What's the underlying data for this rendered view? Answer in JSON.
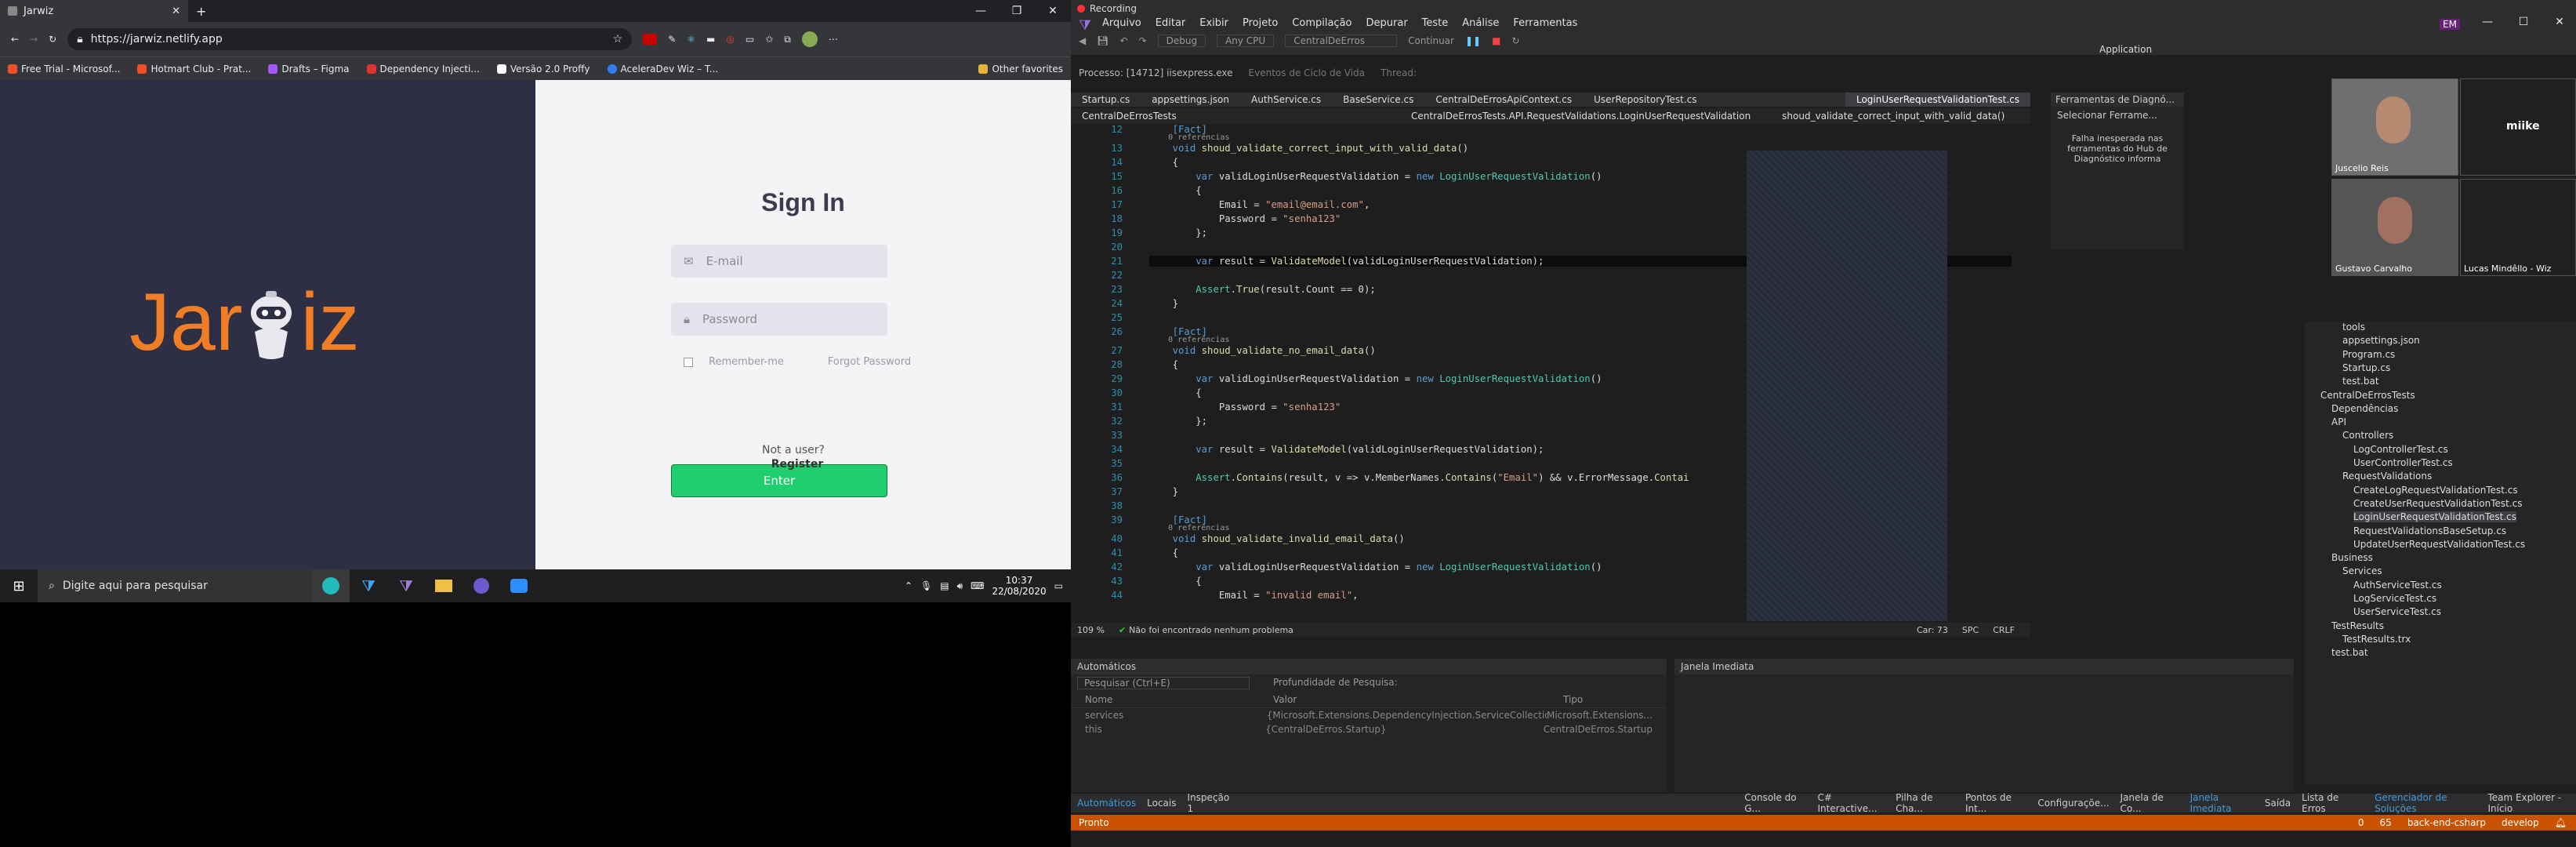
{
  "browser": {
    "tab_title": "Jarwiz",
    "url": "https://jarwiz.netlify.app",
    "bookmarks": [
      "Free Trial - Microsof...",
      "Hotmart Club - Prat...",
      "Drafts – Figma",
      "Dependency Injecti...",
      "Versão 2.0 Proffy",
      "AceleraDev Wiz – T..."
    ],
    "other_favorites": "Other favorites"
  },
  "app": {
    "logo_left": "Jar",
    "logo_right": "iz",
    "signin_title": "Sign In",
    "email_placeholder": "E-mail",
    "password_placeholder": "Password",
    "remember": "Remember-me",
    "forgot": "Forgot Password",
    "enter": "Enter",
    "not_user": "Not a user?",
    "register": "Register"
  },
  "taskbar": {
    "search": "Digite aqui para pesquisar",
    "time": "10:37",
    "date": "22/08/2020"
  },
  "vs": {
    "recording": "Recording",
    "menu": [
      "Arquivo",
      "Editar",
      "Exibir",
      "Projeto",
      "Compilação",
      "Depurar",
      "Teste",
      "Análise",
      "Ferramentas"
    ],
    "user_badge": "EM",
    "process": "Processo:  [14712] iisexpress.exe",
    "events": "Eventos de Ciclo de Vida",
    "thread": "Thread:",
    "debug": "Debug",
    "cpu": "Any CPU",
    "proj": "CentralDeErros",
    "cont": "Continuar",
    "doc_tabs": [
      "Startup.cs",
      "appsettings.json",
      "AuthService.cs",
      "BaseService.cs",
      "CentralDeErrosApiContext.cs",
      "UserRepositoryTest.cs",
      "LoginUserRequestValidationTest.cs"
    ],
    "nav_project": "CentralDeErrosTests",
    "nav_class": "CentralDeErrosTests.API.RequestValidations.LoginUserRequestValidation",
    "nav_method": "shoud_validate_correct_input_with_valid_data()",
    "lines": [
      "12",
      "13",
      "14",
      "15",
      "16",
      "17",
      "18",
      "19",
      "20",
      "21",
      "22",
      "23",
      "24",
      "25",
      "26",
      "27",
      "28",
      "29",
      "30",
      "31",
      "32",
      "33",
      "34",
      "35",
      "36",
      "37",
      "38",
      "39",
      "40",
      "41",
      "42",
      "43",
      "44"
    ],
    "refs": "0 referências",
    "zoom": "109 %",
    "noissue": "Não foi encontrado nenhum problema",
    "col": "Car: 73",
    "spc": "SPC",
    "crlf": "CRLF",
    "autos_title": "Automáticos",
    "autos_search": "Pesquisar (Ctrl+E)",
    "depth": "Profundidade de Pesquisa:",
    "cols": [
      "Nome",
      "Valor",
      "Tipo"
    ],
    "rows": [
      [
        "services",
        "{Microsoft.Extensions.DependencyInjection.ServiceCollection}",
        "Microsoft.Extensions..."
      ],
      [
        "this",
        "{CentralDeErros.Startup}",
        "CentralDeErros.Startup"
      ]
    ],
    "immediate": "Janela Imediata",
    "diag": "Ferramentas de Diagnó...",
    "diag_sel": "Selecionar Ferrame...",
    "diag_msg": "Falha inesperada nas ferramentas do Hub de Diagnóstico informa",
    "bottom_left_tabs": [
      "Automáticos",
      "Locais",
      "Inspeção 1"
    ],
    "bottom_right_tabs": [
      "Console do G...",
      "C# Interactive...",
      "Pilha de Cha...",
      "Pontos de Int...",
      "Configuraçõe...",
      "Janela de Co...",
      "Janela Imediata",
      "Saída",
      "Lista de Erros",
      "Gerenciador de Soluções",
      "Team Explorer - Início"
    ],
    "status_ready": "Pronto",
    "status_items": [
      "0",
      "65",
      "back-end-csharp",
      "develop"
    ],
    "solution": [
      "tools",
      "appsettings.json",
      "Program.cs",
      "Startup.cs",
      "test.bat",
      "CentralDeErrosTests",
      "Dependências",
      "API",
      "Controllers",
      "LogControllerTest.cs",
      "UserControllerTest.cs",
      "RequestValidations",
      "CreateLogRequestValidationTest.cs",
      "CreateUserRequestValidationTest.cs",
      "LoginUserRequestValidationTest.cs",
      "RequestValidationsBaseSetup.cs",
      "UpdateUserRequestValidationTest.cs",
      "Business",
      "Services",
      "AuthServiceTest.cs",
      "LogServiceTest.cs",
      "UserServiceTest.cs",
      "TestResults",
      "TestResults.trx",
      "test.bat"
    ],
    "application": "Application"
  },
  "call": {
    "p1": "Juscelio Reis",
    "p2": "miike",
    "p3": "Gustavo Carvalho",
    "p4": "Lucas Mindêllo - Wiz"
  }
}
